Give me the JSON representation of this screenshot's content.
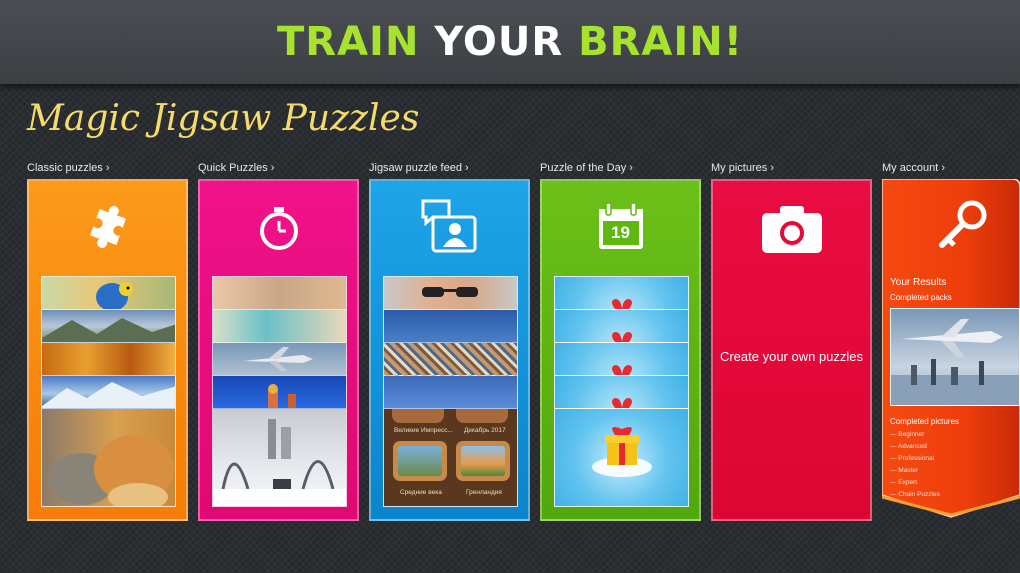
{
  "banner": {
    "word1": "TRAIN",
    "word2": "YOUR",
    "word3": "BRAIN!"
  },
  "app": {
    "title": "Magic Jigsaw Puzzles"
  },
  "colors": {
    "classic": "#fa8a0e",
    "quick": "#ec0a7c",
    "feed": "#1694d8",
    "daily": "#5fb710",
    "pictures": "#e5083a",
    "account": "#f0400e",
    "banner_green": "#a6e22e",
    "title_gold": "#f5dc6a"
  },
  "tiles": {
    "classic": {
      "label": "Classic puzzles",
      "icon": "puzzle-piece-icon"
    },
    "quick": {
      "label": "Quick Puzzles",
      "icon": "stopwatch-icon"
    },
    "feed": {
      "label": "Jigsaw puzzle feed",
      "icon": "chat-profile-icon",
      "packs": [
        "Великие Импресс...",
        "Декабрь 2017",
        "Средние века",
        "Гренландия"
      ]
    },
    "daily": {
      "label": "Puzzle of the Day",
      "icon": "calendar-icon",
      "calendar_day": "19"
    },
    "pictures": {
      "label": "My pictures",
      "icon": "camera-icon",
      "cta": "Create your own puzzles"
    },
    "account": {
      "label": "My account",
      "icon": "key-icon",
      "results_title": "Your Results",
      "completed_packs": "Completed packs",
      "completed_pictures": "Completed pictures",
      "levels": [
        "— Beginner",
        "— Advanced",
        "— Professional",
        "— Master",
        "— Expert",
        "— Chain Puzzles"
      ]
    }
  },
  "chevron": "›"
}
